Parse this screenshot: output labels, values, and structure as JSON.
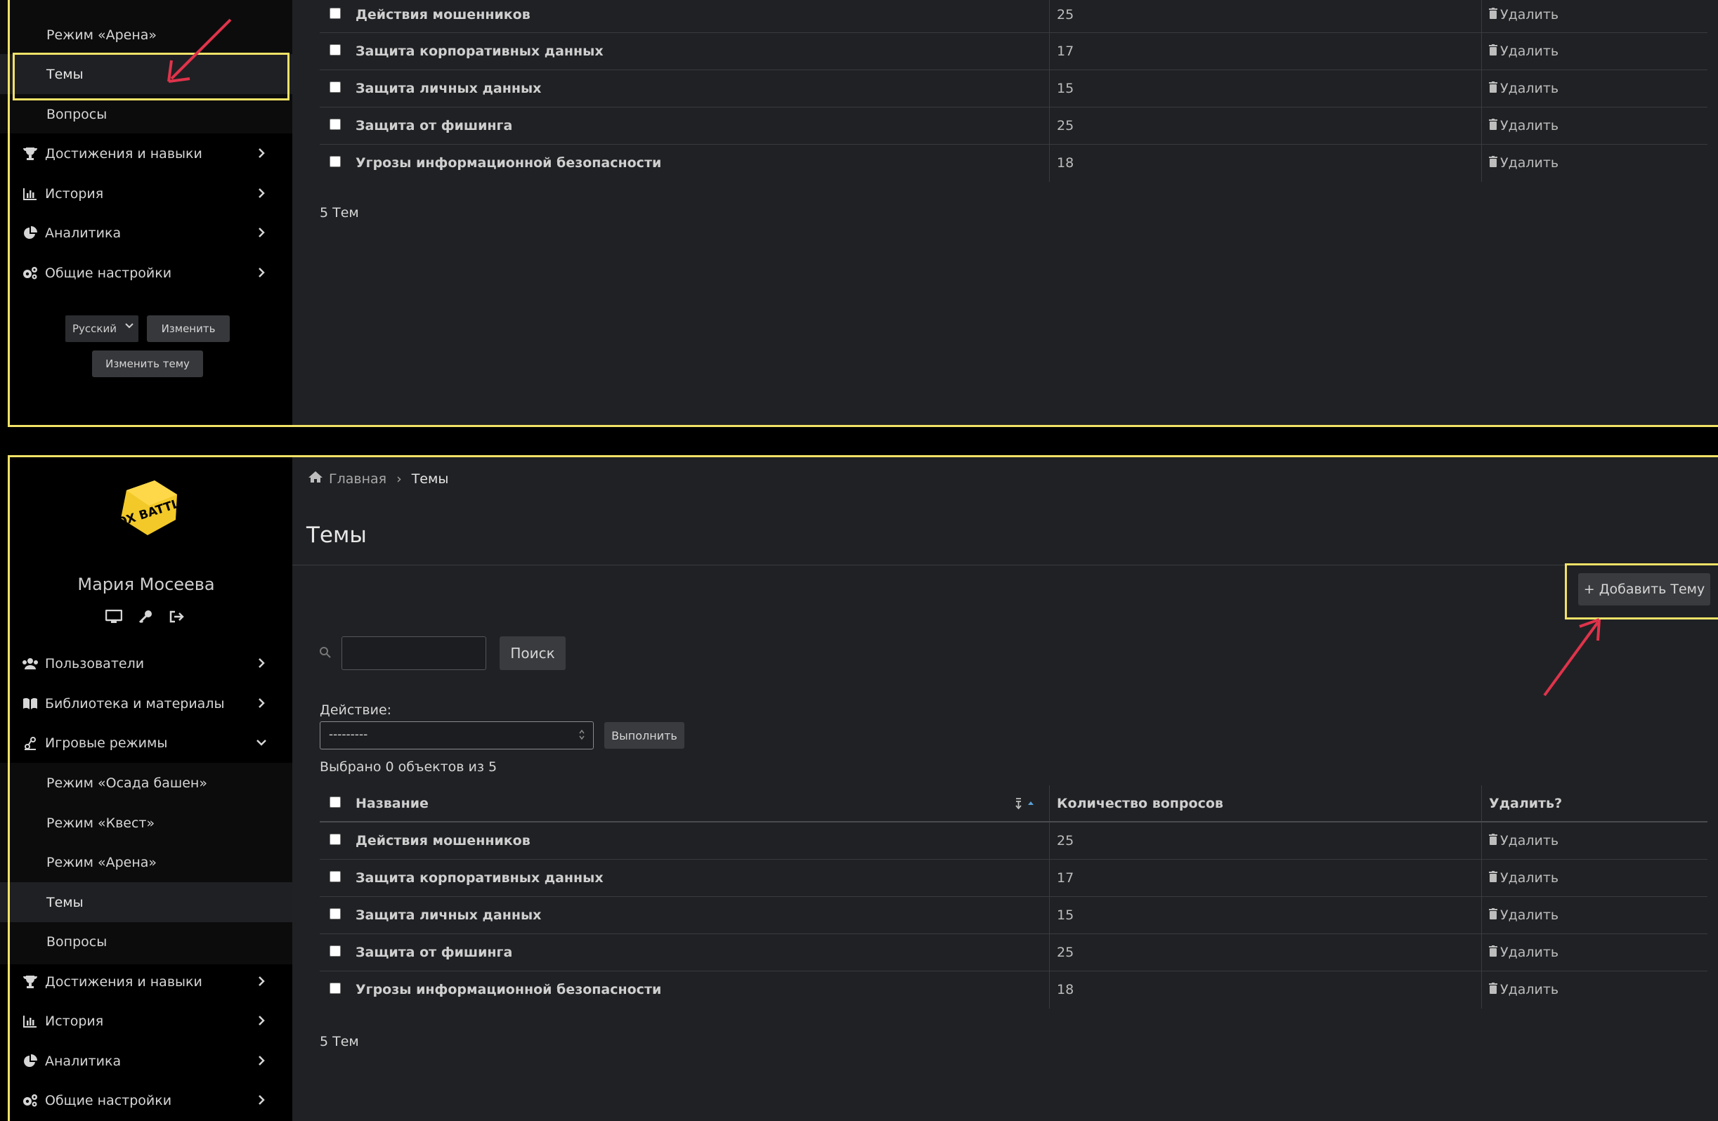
{
  "colors": {
    "highlight": "#f2e267",
    "arrow": "#e0334b",
    "logo": "#f2c928",
    "sidebar_bg": "#000000",
    "main_bg": "#202124"
  },
  "top": {
    "sidebar": {
      "items": [
        {
          "label": "Режим «Арена»",
          "icon": ""
        },
        {
          "label": "Темы",
          "icon": ""
        },
        {
          "label": "Вопросы",
          "icon": ""
        },
        {
          "label": "Достижения и навыки",
          "icon": "trophy-icon"
        },
        {
          "label": "История",
          "icon": "bar-chart-icon"
        },
        {
          "label": "Аналитика",
          "icon": "pie-chart-icon"
        },
        {
          "label": "Общие настройки",
          "icon": "gears-icon"
        }
      ],
      "language": "Русский",
      "change_label": "Изменить",
      "change_theme_label": "Изменить тему"
    },
    "rows": [
      {
        "name": "Действия мошенников",
        "count": "25",
        "delete": "Удалить"
      },
      {
        "name": "Защита корпоративных данных",
        "count": "17",
        "delete": "Удалить"
      },
      {
        "name": "Защита личных данных",
        "count": "15",
        "delete": "Удалить"
      },
      {
        "name": "Защита от фишинга",
        "count": "25",
        "delete": "Удалить"
      },
      {
        "name": "Угрозы информационной безопасности",
        "count": "18",
        "delete": "Удалить"
      }
    ],
    "footer": "5 Тем"
  },
  "bottom": {
    "user_name": "Мария Мосеева",
    "logo_text": "BOX BATTLE",
    "breadcrumb": {
      "home": "Главная",
      "separator": "›",
      "current": "Темы"
    },
    "page_title": "Темы",
    "add_button": "+ Добавить Тему",
    "search_button": "Поиск",
    "search_value": "",
    "action_label": "Действие:",
    "action_select": "---------",
    "run_button": "Выполнить",
    "selected_text": "Выбрано 0 объектов из 5",
    "sidebar": {
      "items": [
        {
          "label": "Пользователи",
          "icon": "users-icon"
        },
        {
          "label": "Библиотека и материалы",
          "icon": "book-icon"
        },
        {
          "label": "Игровые режимы",
          "icon": "game-modes-icon"
        },
        {
          "label": "Режим «Осада башен»",
          "icon": ""
        },
        {
          "label": "Режим «Квест»",
          "icon": ""
        },
        {
          "label": "Режим «Арена»",
          "icon": ""
        },
        {
          "label": "Темы",
          "icon": ""
        },
        {
          "label": "Вопросы",
          "icon": ""
        },
        {
          "label": "Достижения и навыки",
          "icon": "trophy-icon"
        },
        {
          "label": "История",
          "icon": "bar-chart-icon"
        },
        {
          "label": "Аналитика",
          "icon": "pie-chart-icon"
        },
        {
          "label": "Общие настройки",
          "icon": "gears-icon"
        }
      ]
    },
    "table": {
      "headers": {
        "name": "Название",
        "count": "Количество вопросов",
        "delete": "Удалить?"
      },
      "rows": [
        {
          "name": "Действия мошенников",
          "count": "25",
          "delete": "Удалить"
        },
        {
          "name": "Защита корпоративных данных",
          "count": "17",
          "delete": "Удалить"
        },
        {
          "name": "Защита личных данных",
          "count": "15",
          "delete": "Удалить"
        },
        {
          "name": "Защита от фишинга",
          "count": "25",
          "delete": "Удалить"
        },
        {
          "name": "Угрозы информационной безопасности",
          "count": "18",
          "delete": "Удалить"
        }
      ]
    },
    "footer": "5 Тем"
  }
}
